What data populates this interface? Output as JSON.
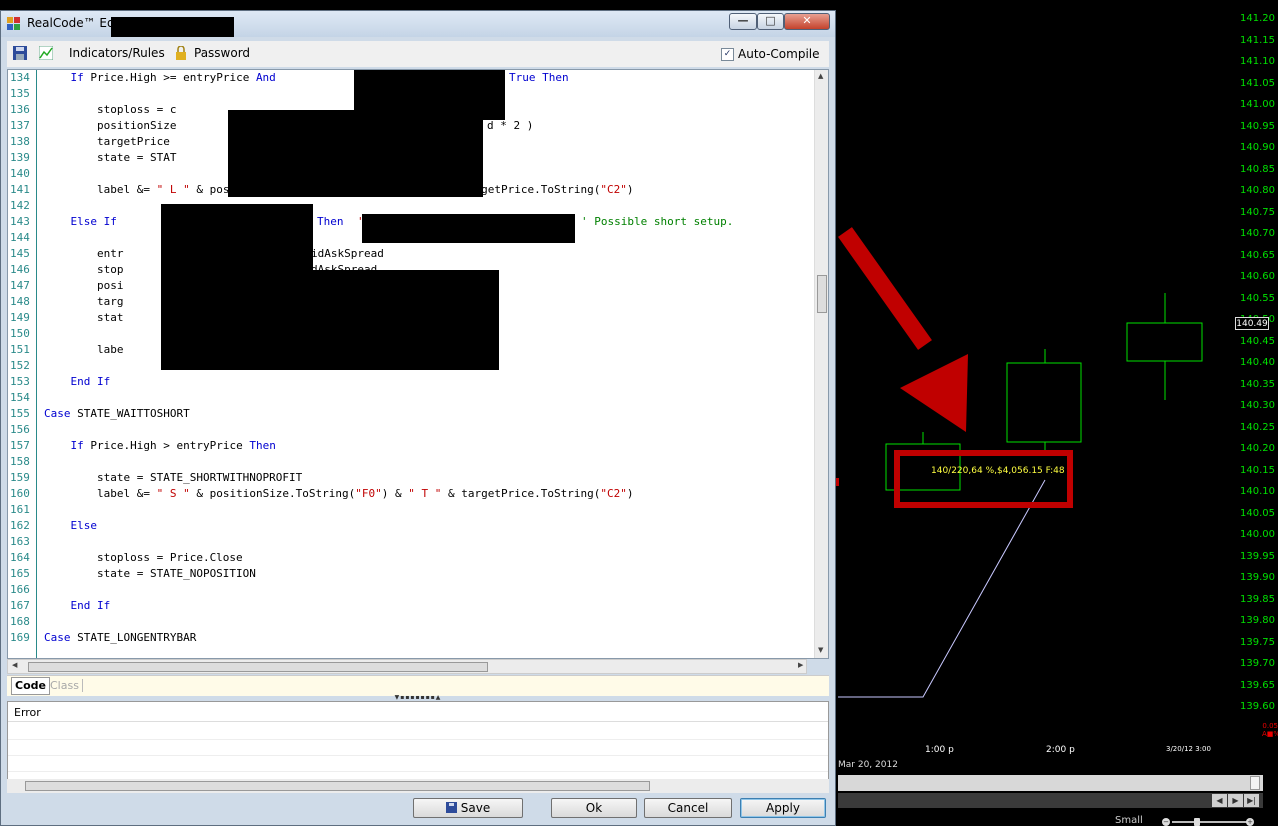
{
  "window": {
    "title": "RealCode™ Edit"
  },
  "toolbar": {
    "indicators_label": "Indicators/Rules",
    "password_label": "Password",
    "autocompile_label": "Auto-Compile",
    "autocompile_checked": true
  },
  "code": {
    "lines": [
      {
        "n": "134",
        "text": "    If Price.High >= entryPrice And"
      },
      {
        "n": "135",
        "text": ""
      },
      {
        "n": "136",
        "text": "        stoploss = c"
      },
      {
        "n": "137",
        "text": "        positionSize"
      },
      {
        "n": "138",
        "text": "        targetPrice"
      },
      {
        "n": "139",
        "text": "        state = STAT"
      },
      {
        "n": "140",
        "text": ""
      },
      {
        "n": "141",
        "text": "        label &= \" L \" & positionSize.ToString(\"F0\") & \" T \" & targetPrice.ToString(\"C2\")"
      },
      {
        "n": "142",
        "text": ""
      },
      {
        "n": "143",
        "text": "    Else If"
      },
      {
        "n": "144",
        "text": ""
      },
      {
        "n": "145",
        "text": "        entr"
      },
      {
        "n": "146",
        "text": "        stop"
      },
      {
        "n": "147",
        "text": "        posi"
      },
      {
        "n": "148",
        "text": "        targ"
      },
      {
        "n": "149",
        "text": "        stat"
      },
      {
        "n": "150",
        "text": ""
      },
      {
        "n": "151",
        "text": "        labe"
      },
      {
        "n": "152",
        "text": ""
      },
      {
        "n": "153",
        "text": "    End If"
      },
      {
        "n": "154",
        "text": ""
      },
      {
        "n": "155",
        "text": "Case STATE_WAITTOSHORT"
      },
      {
        "n": "156",
        "text": ""
      },
      {
        "n": "157",
        "text": "    If Price.High > entryPrice Then"
      },
      {
        "n": "158",
        "text": ""
      },
      {
        "n": "159",
        "text": "        state = STATE_SHORTWITHNOPROFIT"
      },
      {
        "n": "160",
        "text": "        label &= \" S \" & positionSize.ToString(\"F0\") & \" T \" & targetPrice.ToString(\"C2\")"
      },
      {
        "n": "161",
        "text": ""
      },
      {
        "n": "162",
        "text": "    Else"
      },
      {
        "n": "163",
        "text": ""
      },
      {
        "n": "164",
        "text": "        stoploss = Price.Close"
      },
      {
        "n": "165",
        "text": "        state = STATE_NOPOSITION"
      },
      {
        "n": "166",
        "text": ""
      },
      {
        "n": "167",
        "text": "    End If"
      },
      {
        "n": "168",
        "text": ""
      },
      {
        "n": "169",
        "text": "Case STATE_LONGENTRYBAR"
      }
    ],
    "fragments": {
      "true_then": "True Then",
      "l137_tail": "d * 2 )",
      "then_143": "Then",
      "quote_143": "'",
      "comment_143": "' Possible short setup.",
      "l145_tail": "idAskSpread",
      "l146_tail": "dAskSpread"
    }
  },
  "tabs": {
    "code": "Code",
    "class": "Class"
  },
  "error_pane": {
    "header": "Error"
  },
  "buttons": {
    "save": "Save",
    "ok": "Ok",
    "cancel": "Cancel",
    "apply": "Apply"
  },
  "chart": {
    "price_axis": [
      "141.20",
      "141.15",
      "141.10",
      "141.05",
      "141.00",
      "140.95",
      "140.90",
      "140.85",
      "140.80",
      "140.75",
      "140.70",
      "140.65",
      "140.60",
      "140.55",
      "140.50",
      "140.45",
      "140.40",
      "140.35",
      "140.30",
      "140.25",
      "140.20",
      "140.15",
      "140.10",
      "140.05",
      "140.00",
      "139.95",
      "139.90",
      "139.85",
      "139.80",
      "139.75",
      "139.70",
      "139.65",
      "139.60"
    ],
    "current_price": "140.49",
    "time_labels": [
      "1:00 p",
      "2:00 p",
      "3/20/12 3:00"
    ],
    "date_label": "Mar 20, 2012",
    "annotation": "140/220,64 %,$4,056.15 F:48",
    "zoom_label": "Small",
    "side_text": [
      "0.05",
      "A■%X"
    ],
    "accent_red": "#c00000",
    "candle_color": "#00e000"
  }
}
